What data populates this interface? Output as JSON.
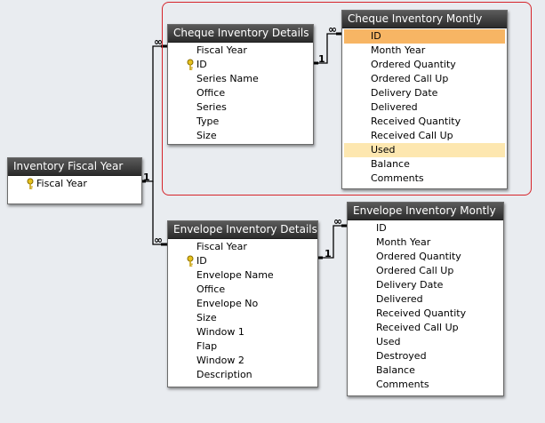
{
  "tables": {
    "inventory_fiscal_year": {
      "title": "Inventory Fiscal Year",
      "fields": [
        "Fiscal Year"
      ]
    },
    "cheque_details": {
      "title": "Cheque Inventory Details",
      "fields": [
        "Fiscal Year",
        "ID",
        "Series Name",
        "Office",
        "Series",
        "Type",
        "Size"
      ]
    },
    "cheque_monthly": {
      "title": "Cheque Inventory Montly",
      "fields": [
        "ID",
        "Month Year",
        "Ordered Quantity",
        "Ordered Call Up",
        "Delivery Date",
        "Delivered",
        "Received Quantity",
        "Received Call Up",
        "Used",
        "Balance",
        "Comments"
      ]
    },
    "envelope_details": {
      "title": "Envelope Inventory Details",
      "fields": [
        "Fiscal Year",
        "ID",
        "Envelope Name",
        "Office",
        "Envelope No",
        "Size",
        "Window 1",
        "Flap",
        "Window 2",
        "Description"
      ]
    },
    "envelope_monthly": {
      "title": "Envelope Inventory Montly",
      "fields": [
        "ID",
        "Month Year",
        "Ordered Quantity",
        "Ordered Call Up",
        "Delivery Date",
        "Delivered",
        "Received Quantity",
        "Received Call Up",
        "Used",
        "Destroyed",
        "Balance",
        "Comments"
      ]
    }
  },
  "relationships": {
    "one_label": "1",
    "many_label": "∞"
  },
  "colors": {
    "title_bar": "#2b2b2b",
    "selected_field": "#f7b564",
    "highlight_field": "#fde7b0",
    "group_frame": "#d6242a"
  },
  "icons": {
    "primary_key": "key-icon"
  }
}
